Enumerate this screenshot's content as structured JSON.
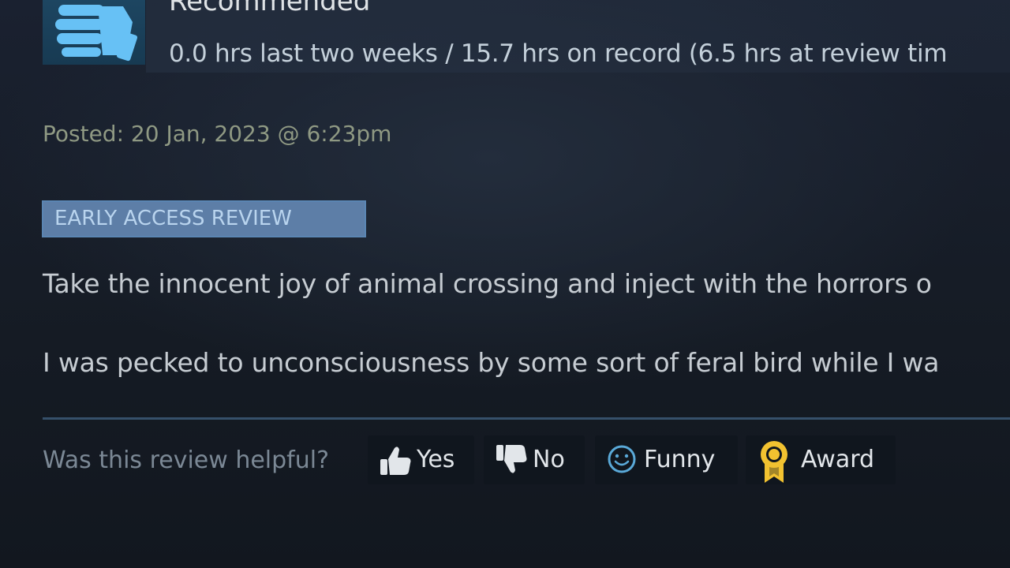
{
  "review": {
    "verdict": "Recommended",
    "hours": "0.0 hrs last two weeks / 15.7 hrs on record (6.5 hrs at review tim",
    "posted": "Posted: 20 Jan, 2023 @ 6:23pm",
    "early_access_tag": "EARLY ACCESS REVIEW",
    "body_lines": [
      "Take the innocent joy of animal crossing and inject with the horrors o",
      "I was pecked to unconsciousness by some sort of feral bird while I wa"
    ]
  },
  "feedback": {
    "prompt": "Was this review helpful?",
    "buttons": [
      {
        "label": "Yes",
        "icon": "thumbs-up-icon"
      },
      {
        "label": "No",
        "icon": "thumbs-down-icon"
      },
      {
        "label": "Funny",
        "icon": "smiley-icon"
      },
      {
        "label": "Award",
        "icon": "award-medal-icon"
      }
    ]
  },
  "colors": {
    "background": "#161c25",
    "tag_background": "#5d7ea7",
    "tag_text": "#b9d4ee",
    "posted_text": "#8f9983",
    "award_gold": "#f2c230",
    "funny_blue": "#5aa9d8"
  }
}
